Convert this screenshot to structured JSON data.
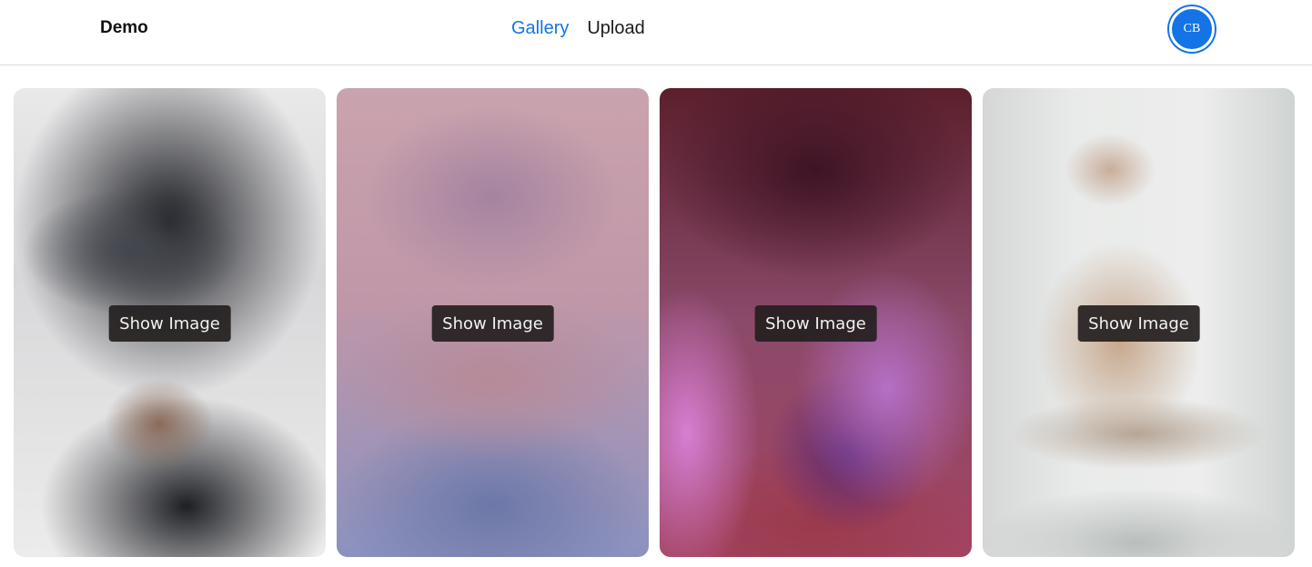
{
  "header": {
    "brand": "Demo",
    "nav": [
      {
        "label": "Gallery",
        "active": true
      },
      {
        "label": "Upload",
        "active": false
      }
    ],
    "avatar_initials": "CB"
  },
  "gallery": {
    "cards": [
      {
        "button_label": "Show Image"
      },
      {
        "button_label": "Show Image"
      },
      {
        "button_label": "Show Image"
      },
      {
        "button_label": "Show Image"
      }
    ]
  },
  "colors": {
    "accent": "#1473e6",
    "button_bg": "#242020"
  }
}
